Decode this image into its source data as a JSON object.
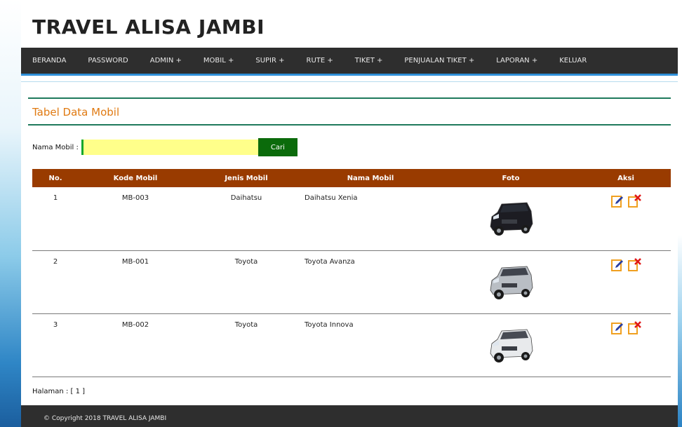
{
  "header": {
    "title": "TRAVEL ALISA JAMBI"
  },
  "nav": [
    {
      "label": "BERANDA"
    },
    {
      "label": "PASSWORD"
    },
    {
      "label": "ADMIN +"
    },
    {
      "label": "MOBIL +"
    },
    {
      "label": "SUPIR +"
    },
    {
      "label": "RUTE +"
    },
    {
      "label": "TIKET +"
    },
    {
      "label": "PENJUALAN TIKET +"
    },
    {
      "label": "LAPORAN +"
    },
    {
      "label": "KELUAR"
    }
  ],
  "section": {
    "title": "Tabel Data Mobil"
  },
  "search": {
    "label": "Nama Mobil :",
    "value": "",
    "button": "Cari"
  },
  "table": {
    "headers": [
      "No.",
      "Kode Mobil",
      "Jenis Mobil",
      "Nama Mobil",
      "Foto",
      "Aksi"
    ],
    "rows": [
      {
        "no": "1",
        "kode": "MB-003",
        "jenis": "Daihatsu",
        "nama": "Daihatsu Xenia",
        "car_color": "#1c1c22"
      },
      {
        "no": "2",
        "kode": "MB-001",
        "jenis": "Toyota",
        "nama": "Toyota Avanza",
        "car_color": "#b9bec4"
      },
      {
        "no": "3",
        "kode": "MB-002",
        "jenis": "Toyota",
        "nama": "Toyota Innova",
        "car_color": "#e8eaec"
      }
    ]
  },
  "pager": {
    "text": "Halaman : [ 1 ]"
  },
  "footer": {
    "text": "© Copyright 2018 TRAVEL ALISA JAMBI"
  },
  "colors": {
    "nav_bg": "#2e2e2e",
    "table_head": "#993b00",
    "section_title": "#e07a12",
    "search_btn": "#0b6b0b"
  },
  "icons": {
    "edit": "edit-icon",
    "delete": "delete-icon"
  }
}
